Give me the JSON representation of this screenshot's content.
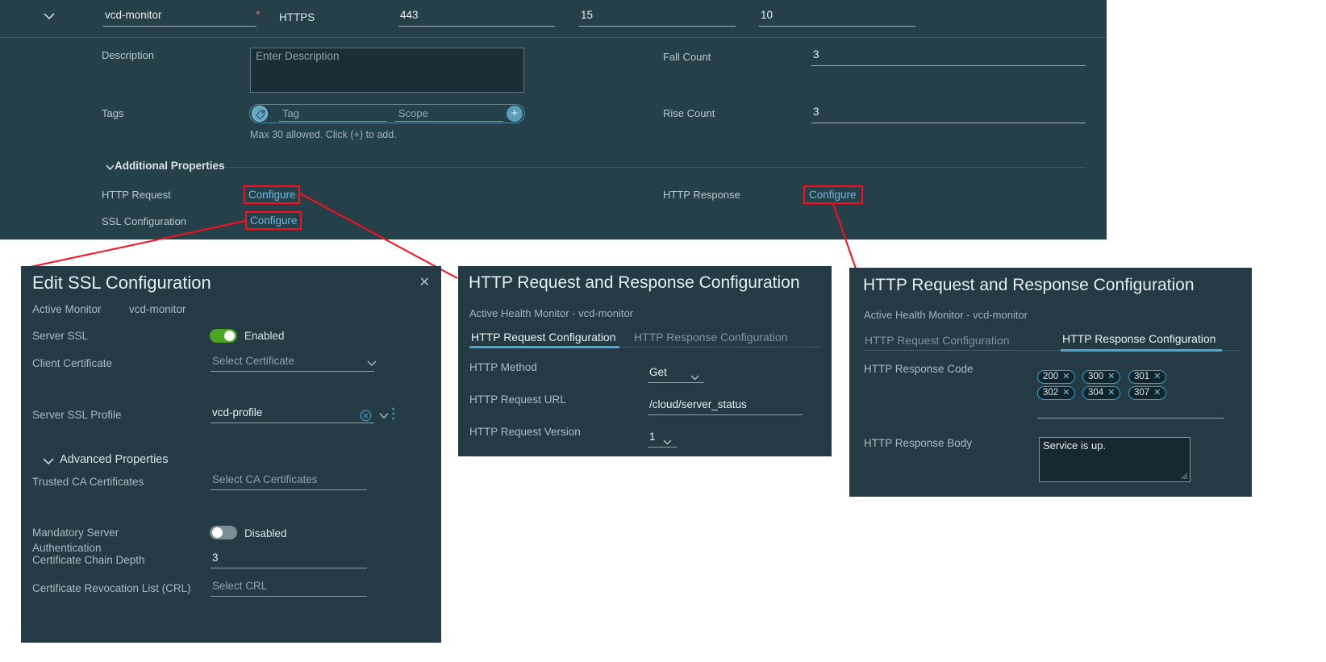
{
  "top_panel": {
    "collapse_icon": "chevron-down-icon",
    "monitor_name": "vcd-monitor",
    "required_marker": "*",
    "protocol": "HTTPS",
    "port": "443",
    "interval": "15",
    "timeout": "10",
    "description_label": "Description",
    "description_placeholder": "Enter Description",
    "tags_label": "Tags",
    "tag_placeholder": "Tag",
    "scope_placeholder": "Scope",
    "tag_add_icon": "plus-circle-icon",
    "tag_icon": "tag-icon",
    "tags_hint": "Max 30 allowed. Click (+) to add.",
    "fall_count_label": "Fall Count",
    "fall_count_value": "3",
    "rise_count_label": "Rise Count",
    "rise_count_value": "3",
    "additional_properties_label": "Additional Properties",
    "http_request_label": "HTTP Request",
    "http_request_link": "Configure",
    "ssl_configuration_label": "SSL Configuration",
    "ssl_configuration_link": "Configure",
    "http_response_label": "HTTP Response",
    "http_response_link": "Configure"
  },
  "ssl_dialog": {
    "title": "Edit SSL Configuration",
    "close_icon": "close-icon",
    "active_monitor_label": "Active Monitor",
    "active_monitor_value": "vcd-monitor",
    "server_ssl_label": "Server SSL",
    "server_ssl_state": "Enabled",
    "client_certificate_label": "Client Certificate",
    "client_certificate_placeholder": "Select Certificate",
    "server_ssl_profile_label": "Server SSL Profile",
    "server_ssl_profile_value": "vcd-profile",
    "clear_icon": "clear-circle-icon",
    "dropdown_icon": "chevron-down-icon",
    "overflow_icon": "kebab-menu-icon",
    "advanced_properties_label": "Advanced Properties",
    "advanced_properties_icon": "chevron-down-icon",
    "trusted_ca_label": "Trusted CA Certificates",
    "trusted_ca_placeholder": "Select CA Certificates",
    "mandatory_auth_label_line1": "Mandatory Server",
    "mandatory_auth_label_line2": "Authentication",
    "mandatory_auth_state": "Disabled",
    "chain_depth_label": "Certificate Chain Depth",
    "chain_depth_value": "3",
    "crl_label": "Certificate Revocation List (CRL)",
    "crl_placeholder": "Select CRL"
  },
  "request_dialog": {
    "title": "HTTP Request and Response Configuration",
    "subtitle": "Active Health Monitor - vcd-monitor",
    "tab_request": "HTTP Request Configuration",
    "tab_response": "HTTP Response Configuration",
    "active_tab": "HTTP Request Configuration",
    "http_method_label": "HTTP Method",
    "http_method_value": "Get",
    "http_request_url_label": "HTTP Request URL",
    "http_request_url_value": "/cloud/server_status",
    "http_request_version_label": "HTTP Request Version",
    "http_request_version_value": "1",
    "dropdown_icon": "chevron-down-icon"
  },
  "response_dialog": {
    "title": "HTTP Request and Response Configuration",
    "subtitle": "Active Health Monitor - vcd-monitor",
    "tab_request": "HTTP Request Configuration",
    "tab_response": "HTTP Response Configuration",
    "active_tab": "HTTP Response Configuration",
    "response_code_label": "HTTP Response Code",
    "response_codes": [
      "200",
      "300",
      "301",
      "302",
      "304",
      "307"
    ],
    "chip_remove_icon": "close-icon",
    "response_body_label": "HTTP Response Body",
    "response_body_value": "Service is up."
  },
  "colors": {
    "panel_bg": "#26404a",
    "dialog_bg": "#243a44",
    "accent_link": "#6cb8e4",
    "annotation_red": "#fc0d1b",
    "toggle_on": "#4aa521",
    "toggle_off": "#7f8e94",
    "tab_active_underline": "#49a7d4",
    "page_bg": "#ffffff"
  }
}
